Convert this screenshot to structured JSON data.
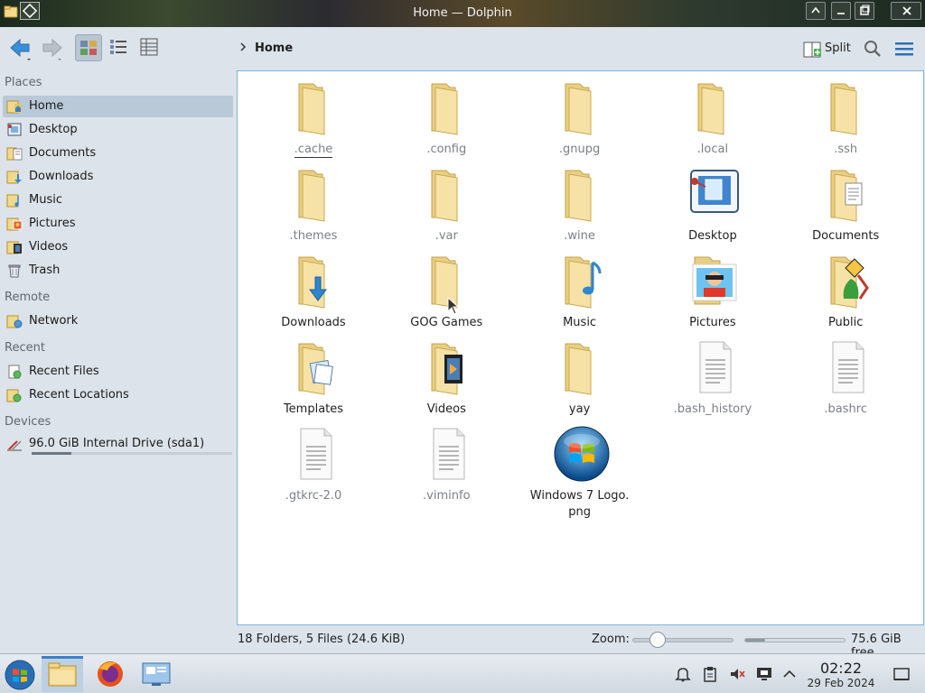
{
  "window": {
    "title": "Home — Dolphin"
  },
  "toolbar": {
    "breadcrumb": "Home",
    "split_label": "Split"
  },
  "sidebar": {
    "sections": {
      "places": "Places",
      "remote": "Remote",
      "recent": "Recent",
      "devices": "Devices"
    },
    "places": [
      "Home",
      "Desktop",
      "Documents",
      "Downloads",
      "Music",
      "Pictures",
      "Videos",
      "Trash"
    ],
    "remote": [
      "Network"
    ],
    "recent": [
      "Recent Files",
      "Recent Locations"
    ],
    "devices": [
      {
        "label": "96.0 GiB Internal Drive (sda1)",
        "usage": 0.2
      }
    ]
  },
  "files": [
    ".cache",
    ".config",
    ".gnupg",
    ".local",
    ".ssh",
    ".themes",
    ".var",
    ".wine",
    "Desktop",
    "Documents",
    "Downloads",
    "GOG Games",
    "Music",
    "Pictures",
    "Public",
    "Templates",
    "Videos",
    "yay",
    ".bash_history",
    ".bashrc",
    ".gtkrc-2.0",
    ".viminfo",
    "Windows 7 Logo.\npng"
  ],
  "status": {
    "summary": "18 Folders, 5 Files (24.6 KiB)",
    "zoom_label": "Zoom:",
    "zoom_level": 0.25,
    "free_space": "75.6 GiB free",
    "disk_used_fraction": 0.2
  },
  "taskbar": {
    "time": "02:22",
    "date": "29 Feb 2024"
  },
  "colors": {
    "accent": "#3d7fc6",
    "selection": "#b9c9d8",
    "folder": "#f3dd99"
  }
}
